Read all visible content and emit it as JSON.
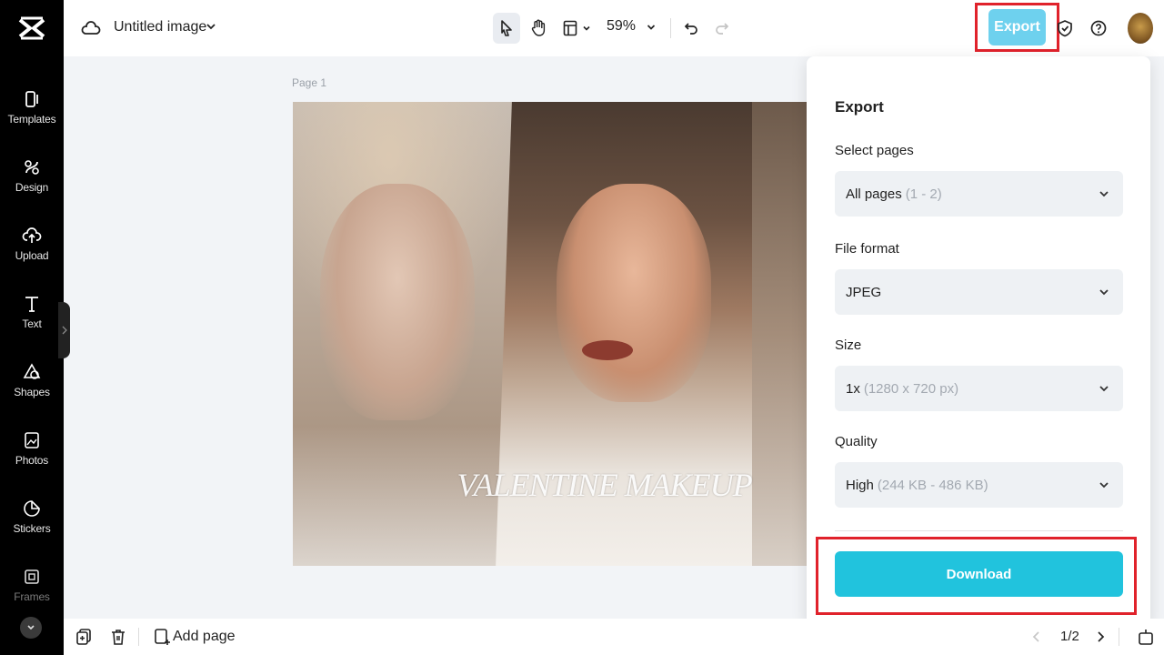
{
  "sidebar": {
    "items": [
      {
        "label": "Templates",
        "icon": "templates-icon"
      },
      {
        "label": "Design",
        "icon": "design-icon"
      },
      {
        "label": "Upload",
        "icon": "upload-icon"
      },
      {
        "label": "Text",
        "icon": "text-icon"
      },
      {
        "label": "Shapes",
        "icon": "shapes-icon"
      },
      {
        "label": "Photos",
        "icon": "photos-icon"
      },
      {
        "label": "Stickers",
        "icon": "stickers-icon"
      },
      {
        "label": "Frames",
        "icon": "frames-icon"
      }
    ]
  },
  "header": {
    "file_title": "Untitled image",
    "zoom": "59%",
    "export_label": "Export"
  },
  "canvas": {
    "page_label": "Page 1",
    "design_title": "VALENTINE MAKEUP"
  },
  "export_panel": {
    "title": "Export",
    "select_pages": {
      "label": "Select pages",
      "value": "All pages",
      "hint": "(1 - 2)"
    },
    "file_format": {
      "label": "File format",
      "value": "JPEG",
      "hint": ""
    },
    "size": {
      "label": "Size",
      "value": "1x",
      "hint": "(1280 x 720 px)"
    },
    "quality": {
      "label": "Quality",
      "value": "High",
      "hint": "(244 KB - 486 KB)"
    },
    "download_label": "Download"
  },
  "footer": {
    "add_page": "Add page",
    "pager": "1/2"
  },
  "colors": {
    "accent": "#21c3dd",
    "export_button": "#6ed1ee",
    "highlight": "#e0222b",
    "rail": "#000000"
  }
}
